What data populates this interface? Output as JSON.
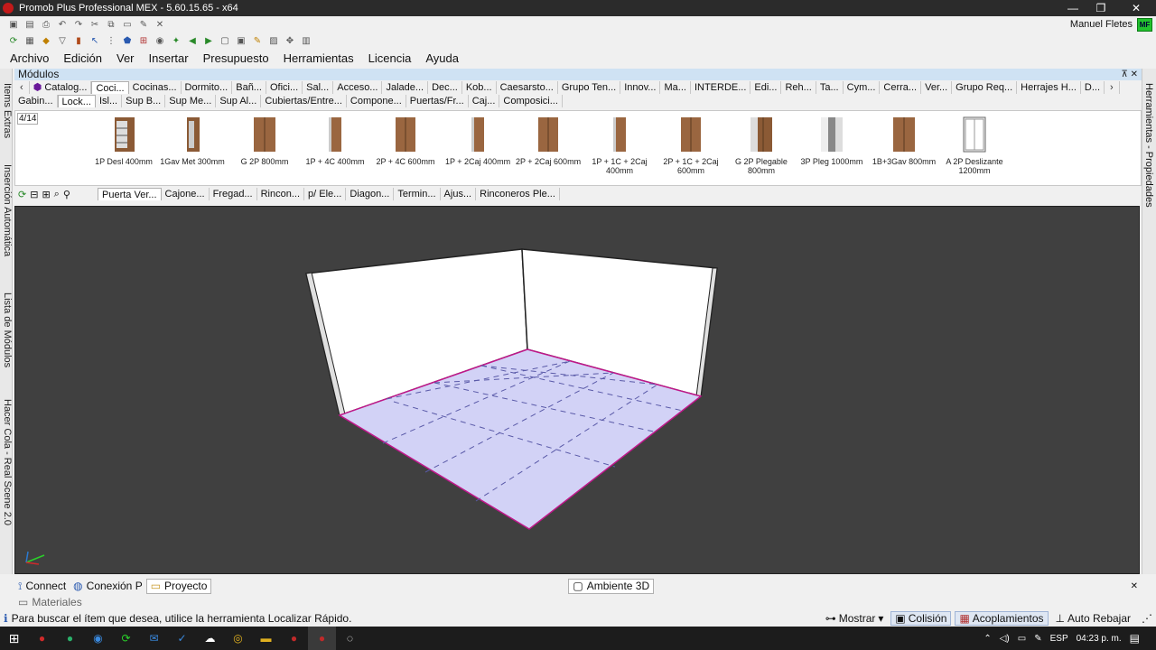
{
  "window": {
    "title": "Promob Plus Professional MEX - 5.60.15.65 - x64",
    "minimize": "—",
    "maximize": "❐",
    "close": "✕"
  },
  "user": {
    "name": "Manuel Fletes",
    "badge": "MF"
  },
  "menu": [
    "Archivo",
    "Edición",
    "Ver",
    "Insertar",
    "Presupuesto",
    "Herramientas",
    "Licencia",
    "Ayuda"
  ],
  "side_left": {
    "items": [
      "Items Extras",
      "Inserción Automática",
      "Lista de Módulos",
      "Hacer Cola - Real Scene 2.0"
    ]
  },
  "side_right": {
    "label": "Herramientas - Propiedades"
  },
  "modules_panel": {
    "title": "Módulos",
    "controls": "⊼ ✕",
    "tabs_row1": [
      "Catalog...",
      "Coci...",
      "Cocinas...",
      "Dormito...",
      "Bañ...",
      "Ofici...",
      "Sal...",
      "Acceso...",
      "Jalade...",
      "Dec...",
      "Kob...",
      "Caesarsto...",
      "Grupo Ten...",
      "Innov...",
      "Ma...",
      "INTERDE...",
      "Edi...",
      "Reh...",
      "Ta...",
      "Cym...",
      "Cerra...",
      "Ver...",
      "Grupo Req...",
      "Herrajes H...",
      "D..."
    ],
    "tabs_row2": [
      "Gabin...",
      "Lock...",
      "Isl...",
      "Sup B...",
      "Sup Me...",
      "Sup Al...",
      "Cubiertas/Entre...",
      "Compone...",
      "Puertas/Fr...",
      "Caj...",
      "Composici..."
    ],
    "page_indicator": "4/14",
    "items": [
      {
        "label": "1P Desl 400mm"
      },
      {
        "label": "1Gav Met 300mm"
      },
      {
        "label": "G 2P 800mm"
      },
      {
        "label": "1P + 4C 400mm"
      },
      {
        "label": "2P + 4C 600mm"
      },
      {
        "label": "1P + 2Caj 400mm"
      },
      {
        "label": "2P + 2Caj 600mm"
      },
      {
        "label": "1P + 1C + 2Caj 400mm"
      },
      {
        "label": "2P + 1C + 2Caj 600mm"
      },
      {
        "label": "G 2P Plegable 800mm"
      },
      {
        "label": "3P Pleg 1000mm"
      },
      {
        "label": "1B+3Gav 800mm"
      },
      {
        "label": "A 2P Deslizante 1200mm"
      }
    ],
    "sub_tabs": [
      "Puerta Ver...",
      "Cajone...",
      "Fregad...",
      "Rincon...",
      "p/ Ele...",
      "Diagon...",
      "Termin...",
      "Ajus...",
      "Rinconeros Ple..."
    ]
  },
  "bottom_tabs": [
    {
      "label": "Connect"
    },
    {
      "label": "Conexión P"
    },
    {
      "label": "Proyecto"
    }
  ],
  "view_tab": {
    "label": "Ambiente 3D"
  },
  "materials": {
    "label": "Materiales"
  },
  "status": {
    "message": "Para buscar el ítem que desea, utilice la herramienta Localizar Rápido.",
    "mostrar": "Mostrar",
    "colision": "Colisión",
    "acoplamientos": "Acoplamientos",
    "auto_rebajar": "Auto Rebajar"
  },
  "taskbar": {
    "language": "ESP",
    "time": "04:23 p. m."
  }
}
